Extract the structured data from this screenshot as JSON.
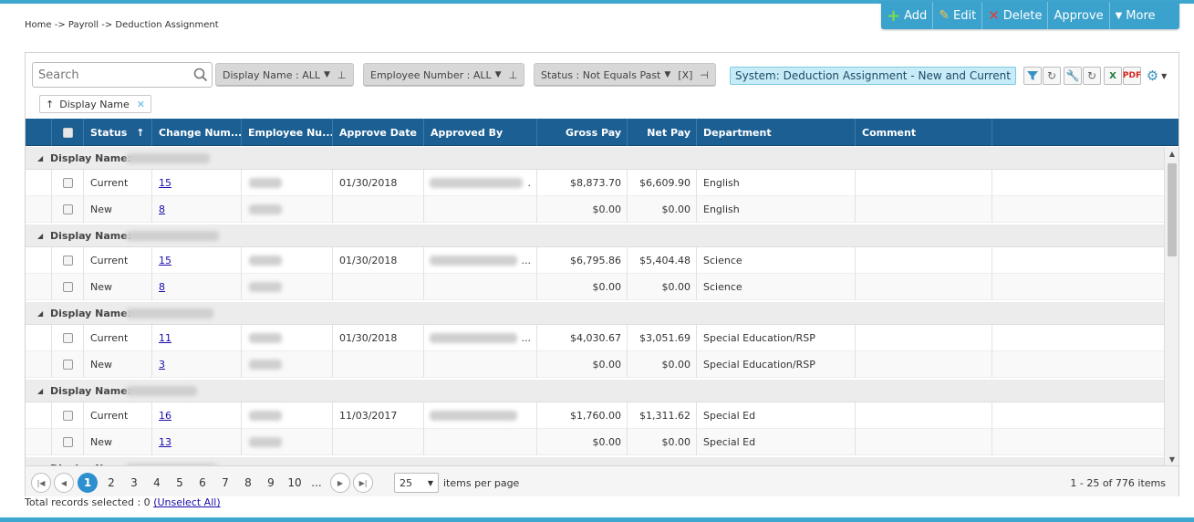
{
  "breadcrumb": "Home -> Payroll -> Deduction Assignment",
  "actions": {
    "add": "Add",
    "edit": "Edit",
    "delete": "Delete",
    "approve": "Approve",
    "more": "More"
  },
  "search": {
    "placeholder": "Search"
  },
  "filters": {
    "display_name": "Display Name : ALL",
    "employee_number": "Employee Number : ALL",
    "status": "Status : Not Equals Past",
    "status_clear": "[X]"
  },
  "system_view": "System: Deduction Assignment - New and Current",
  "group_chip": "Display Name",
  "columns": {
    "status": "Status",
    "sort_arrow": "↑",
    "change_number": "Change Num...",
    "employee_number": "Employee Nu...",
    "approve_date": "Approve Date",
    "approved_by": "Approved By",
    "gross_pay": "Gross Pay",
    "net_pay": "Net Pay",
    "department": "Department",
    "comment": "Comment"
  },
  "group_label": "Display Name:",
  "groups": [
    {
      "rows": [
        {
          "status": "Current",
          "change": "15",
          "approve_date": "01/30/2018",
          "approved_by": ".",
          "gross": "$8,873.70",
          "net": "$6,609.90",
          "dept": "English"
        },
        {
          "status": "New",
          "change": "8",
          "approve_date": "",
          "approved_by": "",
          "gross": "$0.00",
          "net": "$0.00",
          "dept": "English"
        }
      ]
    },
    {
      "rows": [
        {
          "status": "Current",
          "change": "15",
          "approve_date": "01/30/2018",
          "approved_by": "...",
          "gross": "$6,795.86",
          "net": "$5,404.48",
          "dept": "Science"
        },
        {
          "status": "New",
          "change": "8",
          "approve_date": "",
          "approved_by": "",
          "gross": "$0.00",
          "net": "$0.00",
          "dept": "Science"
        }
      ]
    },
    {
      "rows": [
        {
          "status": "Current",
          "change": "11",
          "approve_date": "01/30/2018",
          "approved_by": "...",
          "gross": "$4,030.67",
          "net": "$3,051.69",
          "dept": "Special Education/RSP"
        },
        {
          "status": "New",
          "change": "3",
          "approve_date": "",
          "approved_by": "",
          "gross": "$0.00",
          "net": "$0.00",
          "dept": "Special Education/RSP"
        }
      ]
    },
    {
      "rows": [
        {
          "status": "Current",
          "change": "16",
          "approve_date": "11/03/2017",
          "approved_by": "",
          "gross": "$1,760.00",
          "net": "$1,311.62",
          "dept": "Special Ed"
        },
        {
          "status": "New",
          "change": "13",
          "approve_date": "",
          "approved_by": "",
          "gross": "$0.00",
          "net": "$0.00",
          "dept": "Special Ed"
        }
      ]
    }
  ],
  "pager": {
    "pages": [
      "1",
      "2",
      "3",
      "4",
      "5",
      "6",
      "7",
      "8",
      "9",
      "10",
      "..."
    ],
    "current": "1",
    "page_size": "25",
    "items_per_page": "items per page",
    "info": "1 - 25 of 776 items"
  },
  "footer": {
    "text": "Total records selected : 0",
    "unselect": "(Unselect All)"
  },
  "colors": {
    "accent": "#3aa2cc",
    "header": "#1b5f93",
    "link": "#1a0dab",
    "active_page": "#2d8fd0"
  }
}
